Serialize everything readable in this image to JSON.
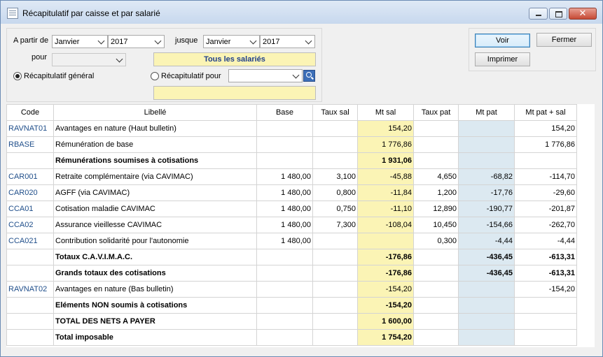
{
  "window": {
    "title": "Récapitulatif par caisse et par salarié",
    "close_label": "✕"
  },
  "filters": {
    "from_label": "A partir de",
    "from_month": "Janvier",
    "from_year": "2017",
    "to_label": "jusque",
    "to_month": "Janvier",
    "to_year": "2017",
    "for_label": "pour",
    "for_value": "",
    "employees_label": "Tous les salariés",
    "radio_general_label": "Récapitulatif général",
    "radio_for_label": "Récapitulatif pour",
    "radio_for_value": "",
    "selection_text": ""
  },
  "actions": {
    "view": "Voir",
    "close": "Fermer",
    "print": "Imprimer"
  },
  "table": {
    "headers": [
      "Code",
      "Libellé",
      "Base",
      "Taux sal",
      "Mt sal",
      "Taux pat",
      "Mt pat",
      "Mt pat + sal"
    ],
    "rows": [
      {
        "code": "RAVNAT01",
        "label": "Avantages en nature (Haut bulletin)",
        "base": "",
        "taux_sal": "",
        "mt_sal": "154,20",
        "taux_pat": "",
        "mt_pat": "",
        "total": "154,20",
        "bold": false
      },
      {
        "code": "RBASE",
        "label": "Rémunération de base",
        "base": "",
        "taux_sal": "",
        "mt_sal": "1 776,86",
        "taux_pat": "",
        "mt_pat": "",
        "total": "1 776,86",
        "bold": false
      },
      {
        "code": "",
        "label": "Rémunérations soumises à cotisations",
        "base": "",
        "taux_sal": "",
        "mt_sal": "1 931,06",
        "taux_pat": "",
        "mt_pat": "",
        "total": "",
        "bold": true
      },
      {
        "code": "CAR001",
        "label": "Retraite complémentaire (via CAVIMAC)",
        "base": "1 480,00",
        "taux_sal": "3,100",
        "mt_sal": "-45,88",
        "taux_pat": "4,650",
        "mt_pat": "-68,82",
        "total": "-114,70",
        "bold": false
      },
      {
        "code": "CAR020",
        "label": "AGFF (via CAVIMAC)",
        "base": "1 480,00",
        "taux_sal": "0,800",
        "mt_sal": "-11,84",
        "taux_pat": "1,200",
        "mt_pat": "-17,76",
        "total": "-29,60",
        "bold": false
      },
      {
        "code": "CCA01",
        "label": "Cotisation maladie CAVIMAC",
        "base": "1 480,00",
        "taux_sal": "0,750",
        "mt_sal": "-11,10",
        "taux_pat": "12,890",
        "mt_pat": "-190,77",
        "total": "-201,87",
        "bold": false
      },
      {
        "code": "CCA02",
        "label": "Assurance vieillesse CAVIMAC",
        "base": "1 480,00",
        "taux_sal": "7,300",
        "mt_sal": "-108,04",
        "taux_pat": "10,450",
        "mt_pat": "-154,66",
        "total": "-262,70",
        "bold": false
      },
      {
        "code": "CCA021",
        "label": "Contribution solidarité pour l'autonomie",
        "base": "1 480,00",
        "taux_sal": "",
        "mt_sal": "",
        "taux_pat": "0,300",
        "mt_pat": "-4,44",
        "total": "-4,44",
        "bold": false
      },
      {
        "code": "",
        "label": "Totaux C.A.V.I.M.A.C.",
        "base": "",
        "taux_sal": "",
        "mt_sal": "-176,86",
        "taux_pat": "",
        "mt_pat": "-436,45",
        "total": "-613,31",
        "bold": true
      },
      {
        "code": "",
        "label": "Grands totaux des cotisations",
        "base": "",
        "taux_sal": "",
        "mt_sal": "-176,86",
        "taux_pat": "",
        "mt_pat": "-436,45",
        "total": "-613,31",
        "bold": true
      },
      {
        "code": "RAVNAT02",
        "label": "Avantages en nature (Bas bulletin)",
        "base": "",
        "taux_sal": "",
        "mt_sal": "-154,20",
        "taux_pat": "",
        "mt_pat": "",
        "total": "-154,20",
        "bold": false
      },
      {
        "code": "",
        "label": "Eléments NON soumis à cotisations",
        "base": "",
        "taux_sal": "",
        "mt_sal": "-154,20",
        "taux_pat": "",
        "mt_pat": "",
        "total": "",
        "bold": true
      },
      {
        "code": "",
        "label": "TOTAL DES NETS A PAYER",
        "base": "",
        "taux_sal": "",
        "mt_sal": "1 600,00",
        "taux_pat": "",
        "mt_pat": "",
        "total": "",
        "bold": true
      },
      {
        "code": "",
        "label": "Total imposable",
        "base": "",
        "taux_sal": "",
        "mt_sal": "1 754,20",
        "taux_pat": "",
        "mt_pat": "",
        "total": "",
        "bold": true
      }
    ]
  }
}
